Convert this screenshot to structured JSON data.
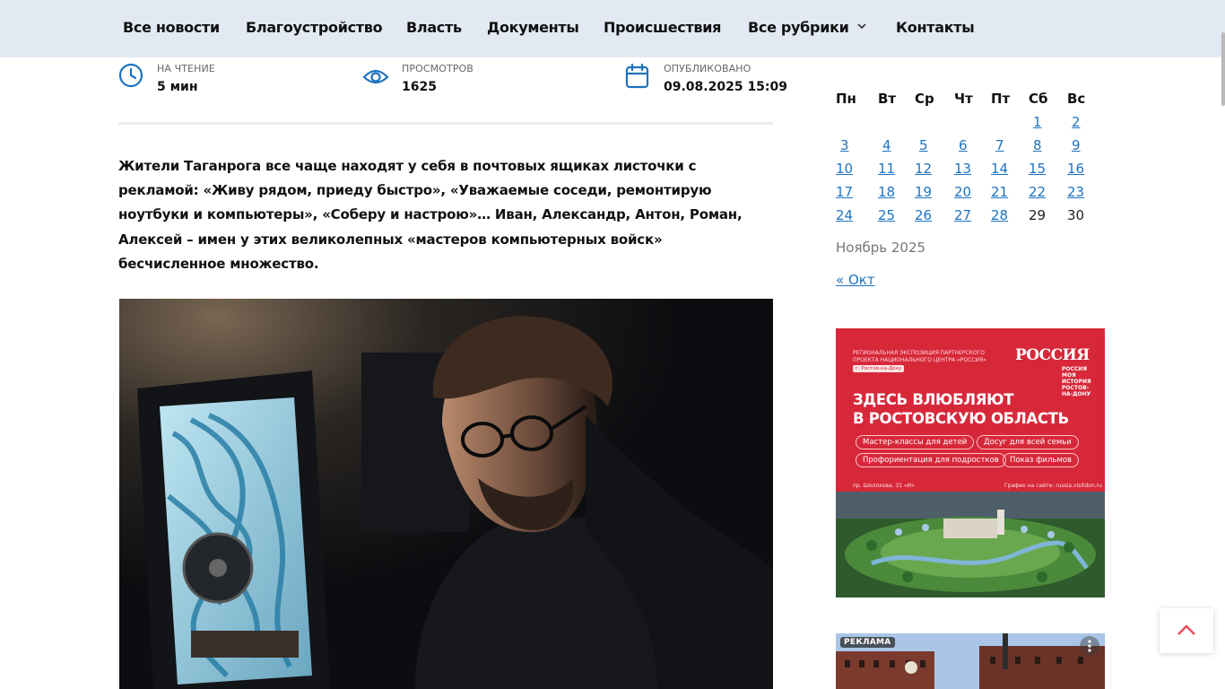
{
  "nav": {
    "items": [
      "Все новости",
      "Благоустройство",
      "Власть",
      "Документы",
      "Происшествия",
      "Все рубрики",
      "Контакты"
    ],
    "dropdown_icon": "chevron-down-icon"
  },
  "article_meta": {
    "reading": {
      "label": "НА ЧТЕНИЕ",
      "value": "5 мин",
      "icon": "clock-icon"
    },
    "views": {
      "label": "ПРОСМОТРОВ",
      "value": "1625",
      "icon": "eye-icon"
    },
    "published": {
      "label": "ОПУБЛИКОВАНО",
      "value": "09.08.2025 15:09",
      "icon": "calendar-icon"
    }
  },
  "lead": {
    "lines": [
      "Жители Таганрога все чаще находят у себя в почтовых ящиках листочки с",
      "рекламой: «Живу рядом, приеду быстро», «Уважаемые соседи, ремонтирую",
      "ноутбуки и компьютеры», «Соберу и настрою»… Иван, Александр, Антон, Роман,",
      "Алексей – имен у этих великолепных «мастеров компьютерных войск»",
      "бесчисленное множество."
    ]
  },
  "article_image": {
    "alt": "man with glasses repairing a computer"
  },
  "calendar": {
    "weekdays": [
      "Пн",
      "Вт",
      "Ср",
      "Чт",
      "Пт",
      "Сб",
      "Вс"
    ],
    "weeks": [
      [
        "",
        "",
        "",
        "",
        "",
        "1",
        "2"
      ],
      [
        "3",
        "4",
        "5",
        "6",
        "7",
        "8",
        "9"
      ],
      [
        "10",
        "11",
        "12",
        "13",
        "14",
        "15",
        "16"
      ],
      [
        "17",
        "18",
        "19",
        "20",
        "21",
        "22",
        "23"
      ],
      [
        "24",
        "25",
        "26",
        "27",
        "28",
        "29",
        "30"
      ]
    ],
    "non_linked_days": [
      "29",
      "30"
    ],
    "caption": "Ноябрь 2025",
    "prev_link": "« Окт"
  },
  "ad_banner": {
    "small_text": "РЕГИОНАЛЬНАЯ ЭКСПОЗИЦИЯ ПАРТНЕРСКОГО ПРОЕКТА НАЦИОНАЛЬНОГО ЦЕНТРА «РОССИЯ»",
    "tag": "г. Ростов-на-Дону",
    "logo": "РОССИЯ",
    "logo_sub": "РОССИЯ МОЯ ИСТОРИЯ РОСТОВ-НА-ДОНУ",
    "headline_1": "ЗДЕСЬ ВЛЮБЛЯЮТ",
    "headline_2": "В РОСТОВСКУЮ ОБЛАСТЬ",
    "pills": [
      "Мастер-классы для детей",
      "Досуг для всей семьи",
      "Профориентация для подростков",
      "Показ фильмов"
    ],
    "address": "пр. Шолохова, 31 «И»",
    "site": "График на сайте: russia.visitdon.ru"
  },
  "ad2": {
    "label": "РЕКЛАМА"
  },
  "colors": {
    "nav_bg": "#e2e9f3",
    "link": "#1e73be",
    "icon_blue": "#1e73be",
    "ad_red": "#d7283a"
  }
}
